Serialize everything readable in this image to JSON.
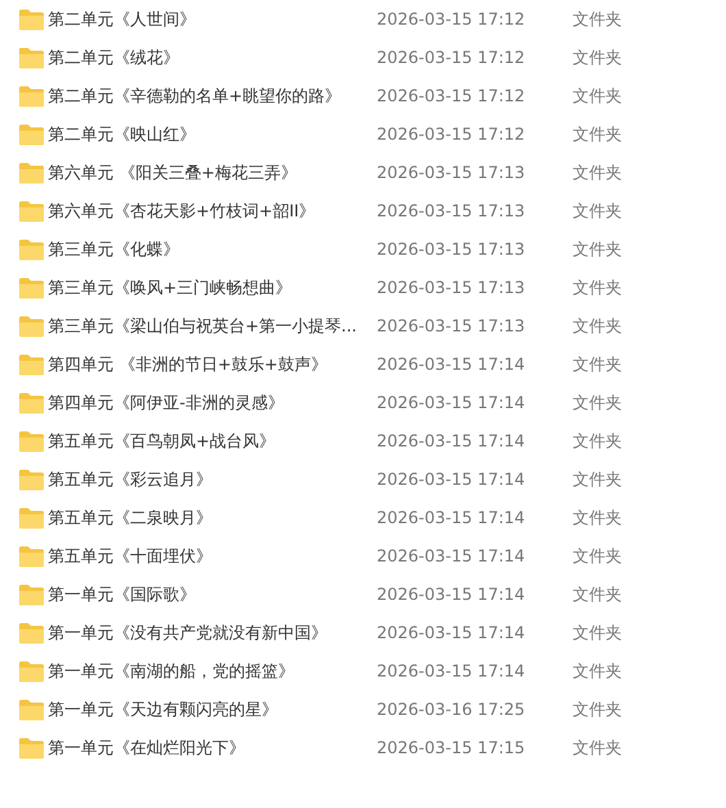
{
  "files": [
    {
      "name": "第二单元《人世间》",
      "modified": "2026-03-15 17:12",
      "type": "文件夹"
    },
    {
      "name": "第二单元《绒花》",
      "modified": "2026-03-15 17:12",
      "type": "文件夹"
    },
    {
      "name": "第二单元《辛德勒的名单+眺望你的路》",
      "modified": "2026-03-15 17:12",
      "type": "文件夹"
    },
    {
      "name": "第二单元《映山红》",
      "modified": "2026-03-15 17:12",
      "type": "文件夹"
    },
    {
      "name": "第六单元 《阳关三叠+梅花三弄》",
      "modified": "2026-03-15 17:13",
      "type": "文件夹"
    },
    {
      "name": "第六单元《杏花天影+竹枝词+韶II》",
      "modified": "2026-03-15 17:13",
      "type": "文件夹"
    },
    {
      "name": "第三单元《化蝶》",
      "modified": "2026-03-15 17:13",
      "type": "文件夹"
    },
    {
      "name": "第三单元《唤风+三门峡畅想曲》",
      "modified": "2026-03-15 17:13",
      "type": "文件夹"
    },
    {
      "name": "第三单元《梁山伯与祝英台+第一小提琴...",
      "modified": "2026-03-15 17:13",
      "type": "文件夹"
    },
    {
      "name": "第四单元 《非洲的节日+鼓乐+鼓声》",
      "modified": "2026-03-15 17:14",
      "type": "文件夹"
    },
    {
      "name": "第四单元《阿伊亚-非洲的灵感》",
      "modified": "2026-03-15 17:14",
      "type": "文件夹"
    },
    {
      "name": "第五单元《百鸟朝凤+战台风》",
      "modified": "2026-03-15 17:14",
      "type": "文件夹"
    },
    {
      "name": "第五单元《彩云追月》",
      "modified": "2026-03-15 17:14",
      "type": "文件夹"
    },
    {
      "name": "第五单元《二泉映月》",
      "modified": "2026-03-15 17:14",
      "type": "文件夹"
    },
    {
      "name": "第五单元《十面埋伏》",
      "modified": "2026-03-15 17:14",
      "type": "文件夹"
    },
    {
      "name": "第一单元《国际歌》",
      "modified": "2026-03-15 17:14",
      "type": "文件夹"
    },
    {
      "name": "第一单元《没有共产党就没有新中国》",
      "modified": "2026-03-15 17:14",
      "type": "文件夹"
    },
    {
      "name": "第一单元《南湖的船，党的摇篮》",
      "modified": "2026-03-15 17:14",
      "type": "文件夹"
    },
    {
      "name": "第一单元《天边有颗闪亮的星》",
      "modified": "2026-03-16 17:25",
      "type": "文件夹"
    },
    {
      "name": "第一单元《在灿烂阳光下》",
      "modified": "2026-03-15 17:15",
      "type": "文件夹"
    }
  ]
}
